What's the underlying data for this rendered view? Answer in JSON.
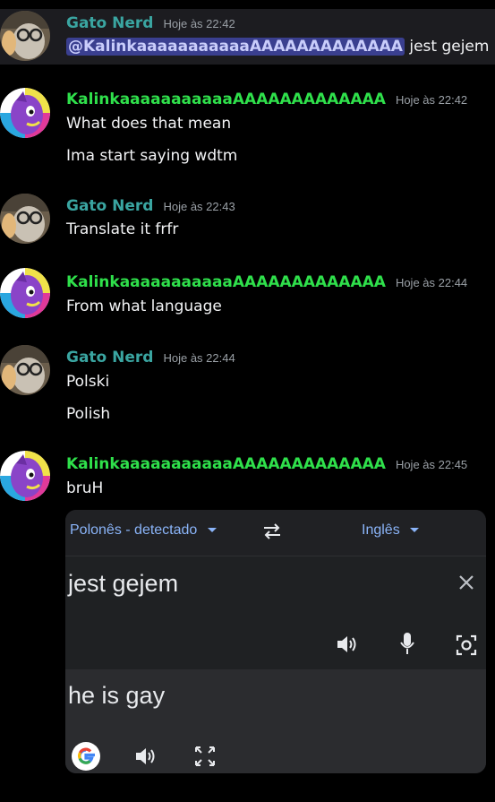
{
  "messages": [
    {
      "user": "Gato Nerd",
      "time": "Hoje às 22:42",
      "mention": "@KalinkaaaaaaaaaaaAAAAAAAAAAAAA",
      "lines": [
        "jest gejem"
      ]
    },
    {
      "user": "KalinkaaaaaaaaaaaAAAAAAAAAAAAA",
      "time": "Hoje às 22:42",
      "lines": [
        "What does that mean",
        "Ima start saying wdtm"
      ]
    },
    {
      "user": "Gato Nerd",
      "time": "Hoje às 22:43",
      "lines": [
        "Translate it frfr"
      ]
    },
    {
      "user": "KalinkaaaaaaaaaaaAAAAAAAAAAAAA",
      "time": "Hoje às 22:44",
      "lines": [
        "From what language"
      ]
    },
    {
      "user": "Gato Nerd",
      "time": "Hoje às 22:44",
      "lines": [
        "Polski",
        "Polish"
      ]
    },
    {
      "user": "KalinkaaaaaaaaaaaAAAAAAAAAAAAA",
      "time": "Hoje às 22:45",
      "lines": [
        "bruH"
      ]
    }
  ],
  "translate": {
    "source_lang": "Polonês - detectado",
    "target_lang": "Inglês",
    "source_text": "jest gejem",
    "output_text": "he is gay",
    "icons": [
      "swap-icon",
      "chevron-down-icon",
      "close-icon",
      "speaker-icon",
      "mic-icon",
      "camera-icon",
      "google-icon",
      "fullscreen-icon"
    ]
  },
  "colors": {
    "gato": "#3aa5a1",
    "kalinka": "#2fe04b",
    "link": "#8ab4f8",
    "mention_bg": "#3a3f8f"
  }
}
